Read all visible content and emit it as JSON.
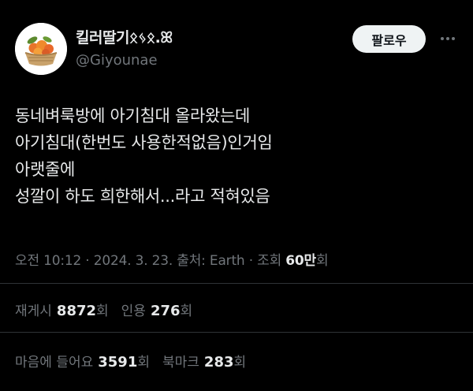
{
  "user": {
    "display_name": "킬러딸기ᛟᛃᛟ.ꕤ",
    "handle": "@Giyounae",
    "follow_label": "팔로우"
  },
  "tweet": {
    "lines": [
      "동네벼룩방에 아기침대 올라왔는데",
      "아기침대(한번도 사용한적없음)인거임",
      "아랫줄에",
      "성깔이 하도 희한해서...라고 적혀있음"
    ]
  },
  "meta": {
    "time": "오전 10:12",
    "date": "2024. 3. 23.",
    "source_prefix": "출처: Earth",
    "views_label": "조회",
    "views_count": "60만",
    "views_suffix": "회",
    "separator": "·"
  },
  "stats": {
    "reposts_label": "재게시",
    "reposts_count": "8872",
    "reposts_suffix": "회",
    "quotes_label": "인용",
    "quotes_count": "276",
    "quotes_suffix": "회",
    "likes_label": "마음에 들어요",
    "likes_count": "3591",
    "likes_suffix": "회",
    "bookmarks_label": "북마크",
    "bookmarks_count": "283",
    "bookmarks_suffix": "회"
  },
  "colors": {
    "background": "#000000",
    "text_primary": "#e7e9ea",
    "text_secondary": "#71767b",
    "divider": "#2f3336",
    "button_bg": "#eff3f4"
  },
  "icons": {
    "avatar": "fruit-basket-avatar",
    "more": "more-dots-icon"
  }
}
